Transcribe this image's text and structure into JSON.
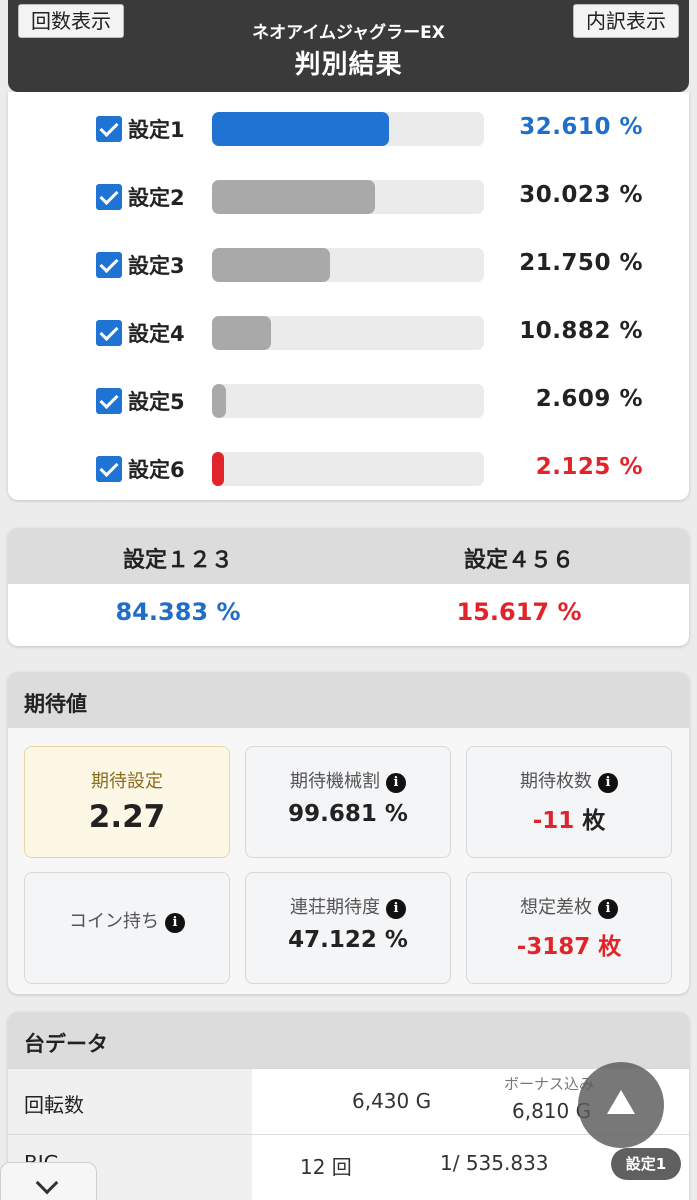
{
  "header": {
    "left_button": "回数表示",
    "right_button": "内訳表示",
    "subtitle": "ネオアイムジャグラーEX",
    "title": "判別結果"
  },
  "settings": [
    {
      "label": "設定1",
      "percent": "32.610 %",
      "value": 32.61,
      "checked": true,
      "bar_color": "#1f73d2",
      "text_color": "#1f6fc8"
    },
    {
      "label": "設定2",
      "percent": "30.023 %",
      "value": 30.023,
      "checked": true,
      "bar_color": "#a9a9a9",
      "text_color": "#222222"
    },
    {
      "label": "設定3",
      "percent": "21.750 %",
      "value": 21.75,
      "checked": true,
      "bar_color": "#a9a9a9",
      "text_color": "#222222"
    },
    {
      "label": "設定4",
      "percent": "10.882 %",
      "value": 10.882,
      "checked": true,
      "bar_color": "#a9a9a9",
      "text_color": "#222222"
    },
    {
      "label": "設定5",
      "percent": "2.609 %",
      "value": 2.609,
      "checked": true,
      "bar_color": "#a9a9a9",
      "text_color": "#222222"
    },
    {
      "label": "設定6",
      "percent": "2.125 %",
      "value": 2.125,
      "checked": true,
      "bar_color": "#e0242a",
      "text_color": "#e0242a"
    }
  ],
  "groups": {
    "low_label": "設定１２３",
    "high_label": "設定４５６",
    "low_value": "84.383 %",
    "high_value": "15.617 %"
  },
  "expectation": {
    "heading": "期待値",
    "expected_setting_label": "期待設定",
    "expected_setting_value": "2.27",
    "payout_label": "期待機械割",
    "payout_value": "99.681 %",
    "coins_label": "期待枚数",
    "coins_value": "-11",
    "coins_unit": "枚",
    "coin_hold_label": "コイン持ち",
    "streak_label": "連荘期待度",
    "streak_value": "47.122 %",
    "diff_label": "想定差枚",
    "diff_value": "-3187 枚",
    "info_glyph": "i"
  },
  "machine": {
    "heading": "台データ",
    "spins_label": "回転数",
    "spins_value": "6,430 G",
    "bonus_included_label": "ボーナス込み",
    "bonus_included_value": "6,810 G",
    "big_label": "BIG",
    "big_count": "12 回",
    "big_ratio": "1/ 535.833"
  },
  "badge": "設定1"
}
